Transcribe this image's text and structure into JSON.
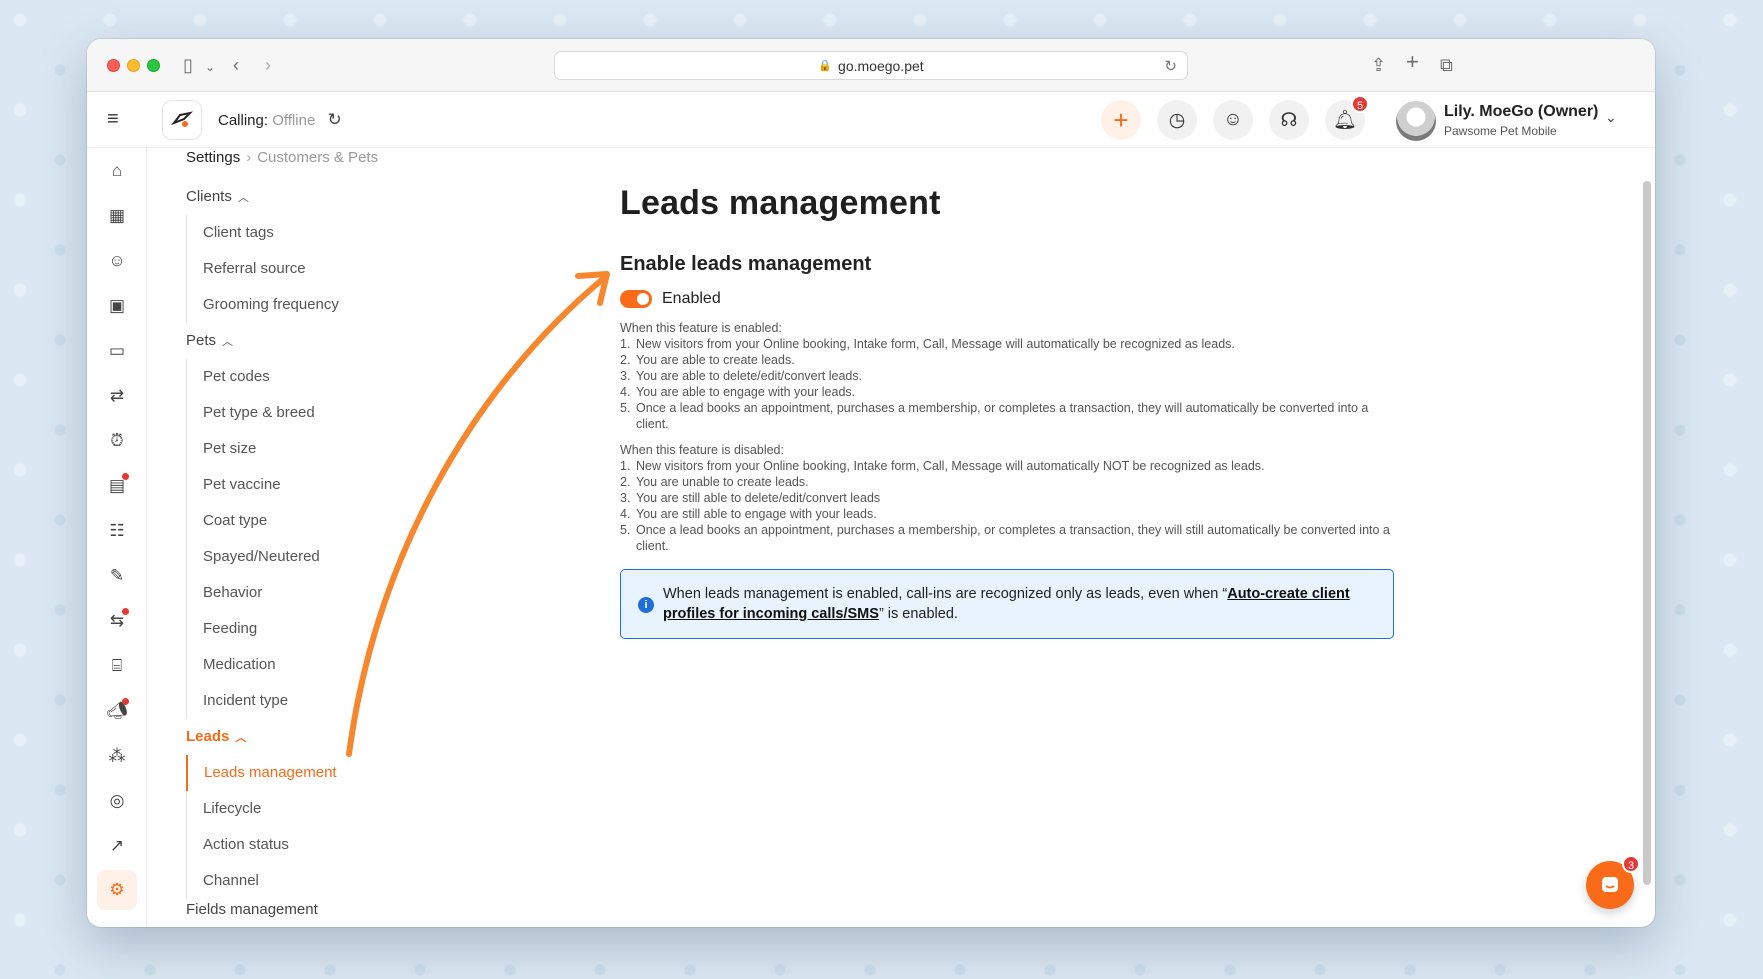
{
  "browser": {
    "url": "go.moego.pet"
  },
  "header": {
    "calling_label": "Calling:",
    "calling_status": "Offline",
    "notifications_count": "5",
    "user_name": "Lily. MoeGo (Owner)",
    "business_name": "Pawsome Pet Mobile",
    "accent_color": "#f96b18"
  },
  "breadcrumb": {
    "root": "Settings",
    "current": "Customers & Pets"
  },
  "nav": {
    "clients_label": "Clients",
    "clients_items": [
      "Client tags",
      "Referral source",
      "Grooming frequency"
    ],
    "pets_label": "Pets",
    "pets_items": [
      "Pet codes",
      "Pet type & breed",
      "Pet size",
      "Pet vaccine",
      "Coat type",
      "Spayed/Neutered",
      "Behavior",
      "Feeding",
      "Medication",
      "Incident type"
    ],
    "leads_label": "Leads",
    "leads_items": [
      "Leads management",
      "Lifecycle",
      "Action status",
      "Channel"
    ],
    "fields_label": "Fields management"
  },
  "main": {
    "title": "Leads management",
    "section_title": "Enable leads management",
    "toggle_label": "Enabled",
    "enabled_heading": "When this feature is enabled:",
    "enabled_items": [
      "New visitors from your Online booking, Intake form, Call, Message will automatically be recognized as leads.",
      "You are able to create leads.",
      "You are able to delete/edit/convert leads.",
      "You are able to engage with your leads.",
      "Once a lead books an appointment, purchases a membership, or completes a transaction, they will automatically be converted into a client."
    ],
    "disabled_heading": "When this feature is disabled:",
    "disabled_items": [
      "New visitors from your Online booking, Intake form, Call, Message will automatically NOT be recognized as leads.",
      "You are unable to create leads.",
      "You are still able to delete/edit/convert leads",
      "You are still able to engage with your leads.",
      "Once a lead books an appointment, purchases a membership, or completes a transaction, they will still automatically be converted into a client."
    ],
    "info_prefix": "When leads management is enabled, call-ins are recognized only as leads, even when “",
    "info_link": "Auto-create client profiles for incoming calls/SMS",
    "info_suffix": "” is enabled."
  },
  "chat": {
    "badge_count": "3"
  }
}
